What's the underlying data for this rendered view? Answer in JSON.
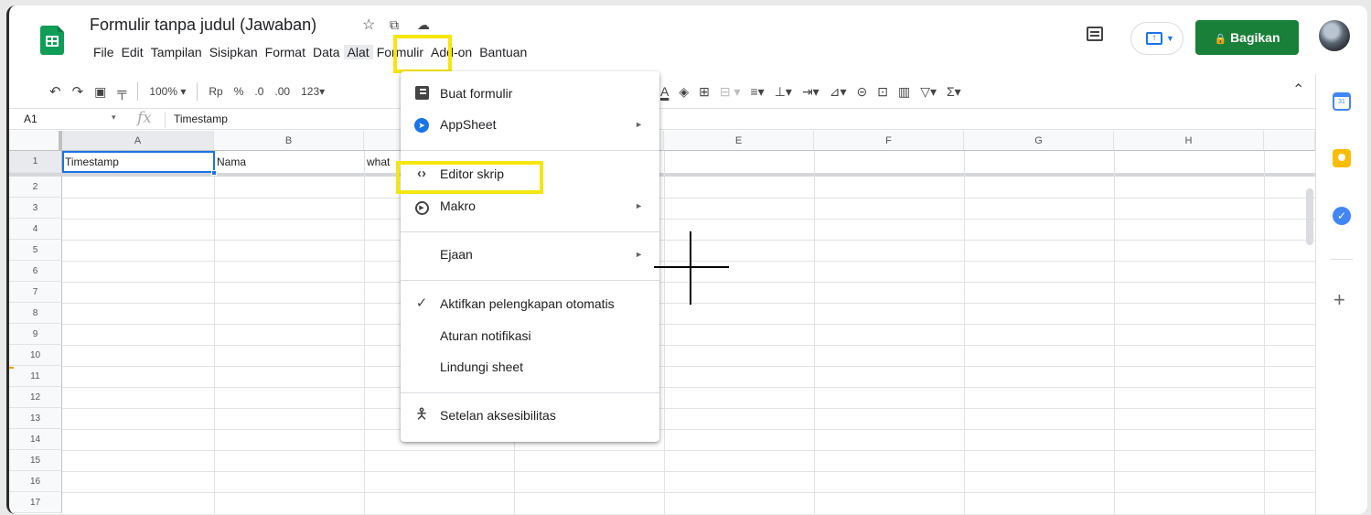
{
  "doc": {
    "title": "Formulir tanpa judul (Jawaban)",
    "star_icon": "☆",
    "move_icon": "⧉",
    "cloud_icon": "☁"
  },
  "menubar": [
    "File",
    "Edit",
    "Tampilan",
    "Sisipkan",
    "Format",
    "Data",
    "Alat",
    "Formulir",
    "Add-on",
    "Bantuan"
  ],
  "menubar_active": "Alat",
  "share": {
    "label": "Bagikan",
    "icon": "🔒"
  },
  "toolbar": {
    "zoom": "100%",
    "currency": "Rp",
    "percent": "%",
    "dec_less": ".0",
    "dec_more": ".00",
    "more_formats": "123"
  },
  "formula_bar": {
    "cell_ref": "A1",
    "fx": "fx",
    "content": "Timestamp"
  },
  "columns": [
    "A",
    "B",
    "C",
    "D",
    "E",
    "F",
    "G",
    "H"
  ],
  "rows": [
    "1",
    "2",
    "3",
    "4",
    "5",
    "6",
    "7",
    "8",
    "9",
    "10",
    "11",
    "12",
    "13",
    "14",
    "15",
    "16",
    "17"
  ],
  "cells": {
    "A1": "Timestamp",
    "B1": "Nama",
    "C1": "what"
  },
  "alat_menu": {
    "items": [
      {
        "label": "Buat formulir",
        "icon": "form-icon",
        "submenu": false
      },
      {
        "label": "AppSheet",
        "icon": "appsheet-icon",
        "submenu": true
      },
      {
        "label": "Editor skrip",
        "icon": "code-icon",
        "submenu": false
      },
      {
        "label": "Makro",
        "icon": "play-circle-icon",
        "submenu": true
      },
      {
        "label": "Ejaan",
        "icon": "",
        "submenu": true
      },
      {
        "label": "Aktifkan pelengkapan otomatis",
        "icon": "check-icon",
        "submenu": false
      },
      {
        "label": "Aturan notifikasi",
        "icon": "",
        "submenu": false
      },
      {
        "label": "Lindungi sheet",
        "icon": "",
        "submenu": false
      },
      {
        "label": "Setelan aksesibilitas",
        "icon": "accessibility-icon",
        "submenu": false
      }
    ]
  },
  "colors": {
    "accent_green": "#188038",
    "sheets_green": "#0f9d58",
    "highlight_yellow": "#f5e610",
    "selection_blue": "#1a73e8"
  }
}
